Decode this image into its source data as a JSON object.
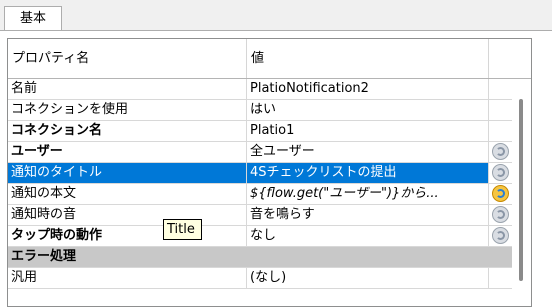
{
  "tab": {
    "label": "基本"
  },
  "grid": {
    "headers": {
      "name": "プロパティ名",
      "value": "値"
    },
    "rows": [
      {
        "name": "名前",
        "value": "PlatioNotification2"
      },
      {
        "name": "コネクションを使用",
        "value": "はい"
      },
      {
        "name": "コネクション名",
        "value": "Platio1"
      },
      {
        "name": "ユーザー",
        "value": "全ユーザー",
        "has_button": true
      },
      {
        "name": "通知のタイトル",
        "value": "4Sチェックリストの提出",
        "has_button": true,
        "selected": true
      },
      {
        "name": "通知の本文",
        "value": "${flow.get(\"ユーザー\")}から...",
        "has_button": true
      },
      {
        "name": "通知時の音",
        "value": "音を鳴らす",
        "has_button": true
      },
      {
        "name": "タップ時の動作",
        "value": "なし",
        "has_button": true
      },
      {
        "name": "エラー処理",
        "value": ""
      },
      {
        "name": "汎用",
        "value": "(なし)"
      }
    ]
  },
  "tooltip": {
    "text": "Title"
  },
  "colors": {
    "selection": "#0078d7",
    "group_header": "#c8c8c8",
    "tooltip_bg": "#ffffe1"
  }
}
